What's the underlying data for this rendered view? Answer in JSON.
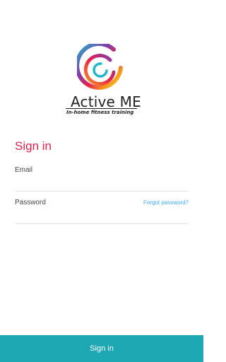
{
  "brand": {
    "name": "Active ME",
    "tagline": "In-home fitness training",
    "logo_icon": "concentric-rings-logo",
    "logo_colors": [
      "#e8204a",
      "#f7941d",
      "#f9d423",
      "#22b8c9",
      "#7b3fb5"
    ]
  },
  "form": {
    "title": "Sign in",
    "email_label": "Email",
    "email_value": "",
    "password_label": "Password",
    "password_value": "",
    "forgot_password": "Forgot password?"
  },
  "actions": {
    "signin_button": "Sign in"
  },
  "colors": {
    "title": "#e8204a",
    "link": "#3fa9f5",
    "button": "#1da8b3"
  }
}
